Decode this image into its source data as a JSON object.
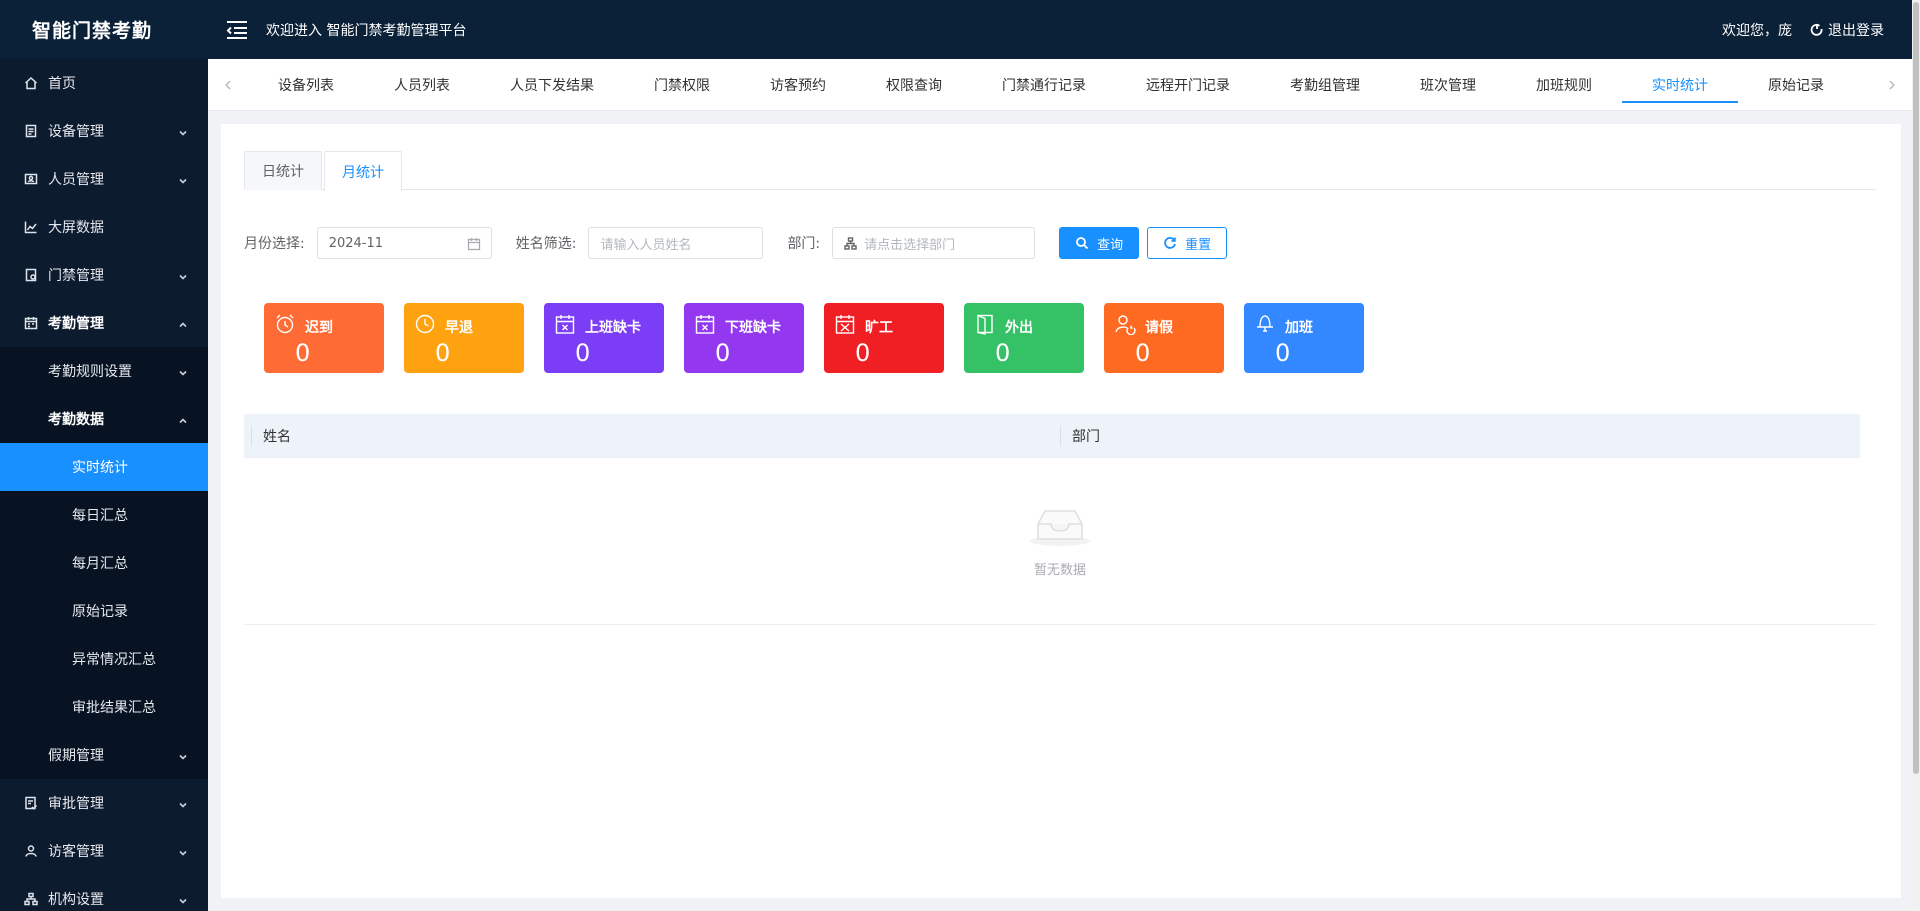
{
  "app": {
    "logo": "智能门禁考勤",
    "header_title": "欢迎进入 智能门禁考勤管理平台",
    "welcome": "欢迎您，庞",
    "logout": "退出登录"
  },
  "sidebar": {
    "items": [
      {
        "label": "首页",
        "icon": "home-icon"
      },
      {
        "label": "设备管理",
        "icon": "device-icon"
      },
      {
        "label": "人员管理",
        "icon": "person-card-icon"
      },
      {
        "label": "大屏数据",
        "icon": "chart-icon"
      },
      {
        "label": "门禁管理",
        "icon": "door-icon"
      },
      {
        "label": "考勤管理",
        "icon": "attendance-icon"
      },
      {
        "label": "考勤规则设置"
      },
      {
        "label": "考勤数据"
      },
      {
        "label": "实时统计"
      },
      {
        "label": "每日汇总"
      },
      {
        "label": "每月汇总"
      },
      {
        "label": "原始记录"
      },
      {
        "label": "异常情况汇总"
      },
      {
        "label": "审批结果汇总"
      },
      {
        "label": "假期管理"
      },
      {
        "label": "审批管理",
        "icon": "approval-icon"
      },
      {
        "label": "访客管理",
        "icon": "user-icon"
      },
      {
        "label": "机构设置",
        "icon": "org-icon"
      }
    ]
  },
  "tabs": [
    "设备列表",
    "人员列表",
    "人员下发结果",
    "门禁权限",
    "访客预约",
    "权限查询",
    "门禁通行记录",
    "远程开门记录",
    "考勤组管理",
    "班次管理",
    "加班规则",
    "实时统计",
    "原始记录"
  ],
  "active_tab": "实时统计",
  "subtabs": [
    "日统计",
    "月统计"
  ],
  "active_subtab": "月统计",
  "filters": {
    "month_label": "月份选择:",
    "month_value": "2024-11",
    "name_label": "姓名筛选:",
    "name_placeholder": "请输入人员姓名",
    "dept_label": "部门:",
    "dept_placeholder": "请点击选择部门",
    "query_button": "查询",
    "reset_button": "重置"
  },
  "stats": [
    {
      "label": "迟到",
      "value": "0",
      "color": "#ff6b35",
      "icon": "alarm-clock-icon"
    },
    {
      "label": "早退",
      "value": "0",
      "color": "#ffa20f",
      "icon": "clock-icon"
    },
    {
      "label": "上班缺卡",
      "value": "0",
      "color": "#7b3df5",
      "icon": "calendar-x-icon"
    },
    {
      "label": "下班缺卡",
      "value": "0",
      "color": "#9438ef",
      "icon": "calendar-x-icon"
    },
    {
      "label": "旷工",
      "value": "0",
      "color": "#f01f24",
      "icon": "calendar-cross-icon"
    },
    {
      "label": "外出",
      "value": "0",
      "color": "#35c165",
      "icon": "door-out-icon"
    },
    {
      "label": "请假",
      "value": "0",
      "color": "#ff6a22",
      "icon": "person-leave-icon"
    },
    {
      "label": "加班",
      "value": "0",
      "color": "#3387ff",
      "icon": "lamp-icon"
    }
  ],
  "table": {
    "columns": [
      "姓名",
      "部门"
    ],
    "empty_text": "暂无数据"
  }
}
